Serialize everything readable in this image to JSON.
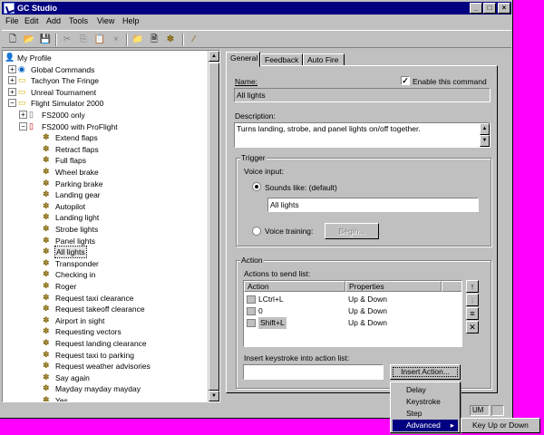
{
  "window": {
    "title": "GC Studio"
  },
  "menu": [
    "File",
    "Edit",
    "Add",
    "Tools",
    "View",
    "Help"
  ],
  "tree": {
    "items": [
      {
        "label": "My Profile",
        "level": 0,
        "icon": "person-icon"
      },
      {
        "label": "Global Commands",
        "level": 1,
        "icon": "globe-icon"
      },
      {
        "label": "Tachyon The Fringe",
        "level": 1,
        "icon": "folder-icon"
      },
      {
        "label": "Unreal Tournament",
        "level": 1,
        "icon": "folder-icon"
      },
      {
        "label": "Flight Simulator 2000",
        "level": 1,
        "icon": "folder-icon"
      },
      {
        "label": "FS2000 only",
        "level": 2,
        "icon": "document-icon"
      },
      {
        "label": "FS2000 with ProFlight",
        "level": 2,
        "icon": "document-red-icon"
      },
      {
        "label": "Extend flaps",
        "level": 3,
        "icon": "command-icon"
      },
      {
        "label": "Retract flaps",
        "level": 3,
        "icon": "command-icon"
      },
      {
        "label": "Full flaps",
        "level": 3,
        "icon": "command-icon"
      },
      {
        "label": "Wheel brake",
        "level": 3,
        "icon": "command-icon"
      },
      {
        "label": "Parking brake",
        "level": 3,
        "icon": "command-icon"
      },
      {
        "label": "Landing gear",
        "level": 3,
        "icon": "command-icon"
      },
      {
        "label": "Autopilot",
        "level": 3,
        "icon": "command-icon"
      },
      {
        "label": "Landing light",
        "level": 3,
        "icon": "command-icon"
      },
      {
        "label": "Strobe lights",
        "level": 3,
        "icon": "command-icon"
      },
      {
        "label": "Panel lights",
        "level": 3,
        "icon": "command-icon"
      },
      {
        "label": "All lights",
        "level": 3,
        "icon": "command-icon",
        "selected": true
      },
      {
        "label": "Transponder",
        "level": 3,
        "icon": "command-icon"
      },
      {
        "label": "Checking in",
        "level": 3,
        "icon": "command-icon"
      },
      {
        "label": "Roger",
        "level": 3,
        "icon": "command-icon"
      },
      {
        "label": "Request taxi clearance",
        "level": 3,
        "icon": "command-icon"
      },
      {
        "label": "Request takeoff clearance",
        "level": 3,
        "icon": "command-icon"
      },
      {
        "label": "Airport in sight",
        "level": 3,
        "icon": "command-icon"
      },
      {
        "label": "Requesting vectors",
        "level": 3,
        "icon": "command-icon"
      },
      {
        "label": "Request landing clearance",
        "level": 3,
        "icon": "command-icon"
      },
      {
        "label": "Request taxi to parking",
        "level": 3,
        "icon": "command-icon"
      },
      {
        "label": "Request weather advisories",
        "level": 3,
        "icon": "command-icon"
      },
      {
        "label": "Say again",
        "level": 3,
        "icon": "command-icon"
      },
      {
        "label": "Mayday mayday mayday",
        "level": 3,
        "icon": "command-icon"
      },
      {
        "label": "Yes",
        "level": 3,
        "icon": "command-icon"
      }
    ]
  },
  "tabs": [
    "General",
    "Feedback",
    "Auto Fire"
  ],
  "general": {
    "name_label": "Name:",
    "name_value": "All lights",
    "enable_label": "Enable this command",
    "description_label": "Description:",
    "description_value": "Turns landing, strobe, and panel lights on/off together.",
    "trigger_title": "Trigger",
    "voice_input_label": "Voice input:",
    "sounds_like_label": "Sounds like: (default)",
    "sounds_like_value": "All lights",
    "voice_training_label": "Voice training:",
    "voice_training_button": "Begin...",
    "action_title": "Action",
    "actions_list_label": "Actions to send list:",
    "columns": [
      "Action",
      "Properties"
    ],
    "actions": [
      {
        "action": "LCtrl+L",
        "properties": "Up & Down"
      },
      {
        "action": "0",
        "properties": "Up & Down"
      },
      {
        "action": "Shift+L",
        "properties": "Up & Down"
      }
    ],
    "insert_label": "Insert keystroke into action list:",
    "insert_value": "",
    "insert_button": "Insert Action..."
  },
  "popup_menu": [
    "Delay",
    "Keystroke",
    "Step",
    "Advanced"
  ],
  "submenu": [
    "Key Up or Down"
  ],
  "status": {
    "num": "UM"
  },
  "colors": {
    "face": "#c0c0c0",
    "titlebar": "#000080",
    "highlight": "#000080",
    "background": "#ff00ff"
  }
}
